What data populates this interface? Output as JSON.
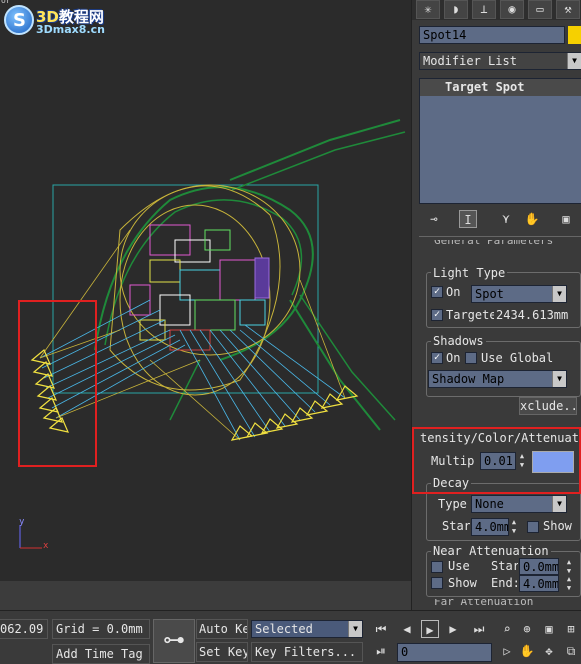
{
  "viewport": {
    "label": "ör",
    "logo": {
      "brand_num": "3D",
      "brand_cn": "教程网",
      "site": "3Dmax8.cn",
      "badge": "S"
    },
    "axis_y": "y",
    "axis_x": "x"
  },
  "command_panel": {
    "tabs": [
      "create-icon",
      "modify-icon",
      "hierarchy-icon",
      "motion-icon",
      "display-icon",
      "utilities-icon"
    ],
    "object_name": "Spot14",
    "object_color": "#f6d000",
    "modifier_list": "Modifier List",
    "stack_item": "Target Spot",
    "general_params_title": "General Parameters",
    "light_type": {
      "title": "Light Type",
      "on_label": "On",
      "on_checked": "✓",
      "type_value": "Spot",
      "targeted_label": "Targete",
      "targeted_checked": "✓",
      "target_distance": "2434.613mm"
    },
    "shadows": {
      "title": "Shadows",
      "on_label": "On",
      "on_checked": "✓",
      "use_global_label": "Use Global",
      "type_value": "Shadow Map",
      "exclude_label": "xclude.."
    },
    "intensity": {
      "title": "tensity/Color/Attenuati",
      "multiplier_label": "Multip:",
      "multiplier_value": "0.01",
      "color": "#7f9ef0"
    },
    "decay": {
      "title": "Decay",
      "type_label": "Type",
      "type_value": "None",
      "start_label": "Star",
      "start_value": "4.0mm",
      "show_label": "Show"
    },
    "near_atten": {
      "title": "Near Attenuation",
      "use_label": "Use",
      "start_label": "Star",
      "start_value": "0.0mm",
      "show_label": "Show",
      "end_label": "End:",
      "end_value": "4.0mm"
    },
    "far_atten_title": "Far Attenuation"
  },
  "bottom": {
    "coord_value": "062.09",
    "grid": "Grid = 0.0mm",
    "add_time_tag": "Add Time Tag",
    "auto_key": "Auto Key",
    "set_key": "Set Key",
    "selected": "Selected",
    "key_filters": "Key Filters...",
    "frame_value": "0"
  }
}
